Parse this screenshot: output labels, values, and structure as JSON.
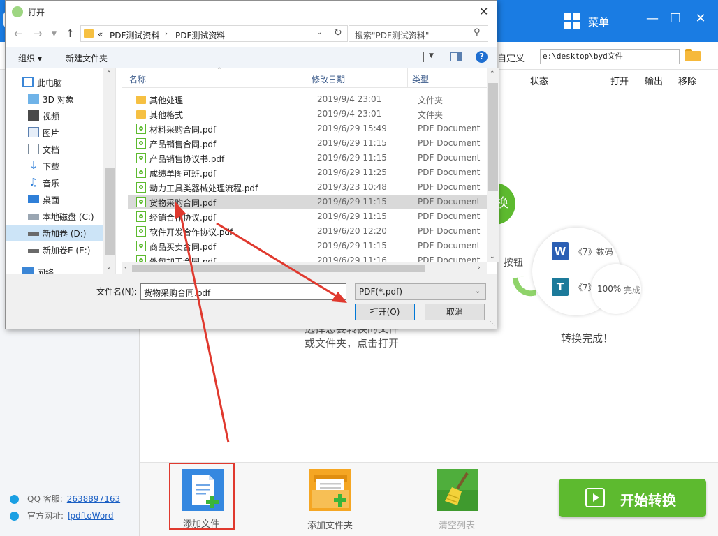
{
  "app": {
    "menu_label": "菜单",
    "custom_label": "自定义",
    "output_path": "e:\\desktop\\byd文件",
    "columns": [
      "状态",
      "打开",
      "输出",
      "移除"
    ],
    "hint_lines": [
      "选择您要转换的文件",
      "或文件夹，点击打开"
    ],
    "convert_button_text": "换",
    "button_hint": "按钮",
    "sample_files": [
      {
        "icon_letter": "W",
        "name": "《7》数码",
        "color": "#2b5fb4"
      },
      {
        "icon_letter": "T",
        "name": "《7》",
        "color": "#1c7a9a"
      }
    ],
    "progress_percent": "100%",
    "progress_label": "完成",
    "done_label": "转换完成！",
    "contact": {
      "qq_label": "QQ 客服:",
      "qq_value": "2638897163",
      "site_label": "官方网址:",
      "site_value": "lpdftoWord"
    },
    "tools": [
      {
        "label": "添加文件"
      },
      {
        "label": "添加文件夹"
      },
      {
        "label": "清空列表"
      }
    ],
    "start_button": "开始转换",
    "colors": {
      "brand_blue": "#1a7ce3",
      "brand_green": "#5dba2f",
      "highlight_red": "#e0392e"
    }
  },
  "dialog": {
    "title": "打开",
    "address": {
      "prefix": "«",
      "segments": [
        "PDF测试资料",
        "PDF测试资料"
      ]
    },
    "search_placeholder": "搜索\"PDF测试资料\"",
    "commands": {
      "organize": "组织 ▾",
      "new_folder": "新建文件夹"
    },
    "nav_tree": [
      {
        "label": "此电脑",
        "icon": "computer-icon"
      },
      {
        "label": "3D 对象",
        "icon": "cube-icon"
      },
      {
        "label": "视频",
        "icon": "video-icon"
      },
      {
        "label": "图片",
        "icon": "picture-icon"
      },
      {
        "label": "文档",
        "icon": "document-icon"
      },
      {
        "label": "下载",
        "icon": "download-icon"
      },
      {
        "label": "音乐",
        "icon": "music-icon"
      },
      {
        "label": "桌面",
        "icon": "desktop-icon"
      },
      {
        "label": "本地磁盘 (C:)",
        "icon": "drive-icon"
      },
      {
        "label": "新加卷 (D:)",
        "icon": "drive-icon",
        "selected": true
      },
      {
        "label": "新加卷E (E:)",
        "icon": "drive-icon"
      },
      {
        "label": "网络",
        "icon": "network-icon"
      }
    ],
    "headers": {
      "name": "名称",
      "date": "修改日期",
      "type": "类型"
    },
    "files": [
      {
        "name": "其他处理",
        "date": "2019/9/4 23:01",
        "type": "文件夹",
        "kind": "folder"
      },
      {
        "name": "其他格式",
        "date": "2019/9/4 23:01",
        "type": "文件夹",
        "kind": "folder"
      },
      {
        "name": "材料采购合同.pdf",
        "date": "2019/6/29 15:49",
        "type": "PDF Document",
        "kind": "pdf"
      },
      {
        "name": "产品销售合同.pdf",
        "date": "2019/6/29 11:15",
        "type": "PDF Document",
        "kind": "pdf"
      },
      {
        "name": "产品销售协议书.pdf",
        "date": "2019/6/29 11:15",
        "type": "PDF Document",
        "kind": "pdf"
      },
      {
        "name": "成绩单图可班.pdf",
        "date": "2019/6/29 11:25",
        "type": "PDF Document",
        "kind": "pdf"
      },
      {
        "name": "动力工具类器械处理流程.pdf",
        "date": "2019/3/23 10:48",
        "type": "PDF Document",
        "kind": "pdf"
      },
      {
        "name": "货物采购合同.pdf",
        "date": "2019/6/29 11:15",
        "type": "PDF Document",
        "kind": "pdf",
        "selected": true
      },
      {
        "name": "经销合作协议.pdf",
        "date": "2019/6/29 11:15",
        "type": "PDF Document",
        "kind": "pdf"
      },
      {
        "name": "软件开发合作协议.pdf",
        "date": "2019/6/20 12:20",
        "type": "PDF Document",
        "kind": "pdf"
      },
      {
        "name": "商品买卖合同.pdf",
        "date": "2019/6/29 11:15",
        "type": "PDF Document",
        "kind": "pdf"
      },
      {
        "name": "外包加工合同.pdf",
        "date": "2019/6/29 11:16",
        "type": "PDF Document",
        "kind": "pdf"
      }
    ],
    "filename_label": "文件名(N):",
    "filename_value": "货物采购合同.pdf",
    "filter_value": "PDF(*.pdf)",
    "open_button": "打开(O)",
    "cancel_button": "取消"
  }
}
